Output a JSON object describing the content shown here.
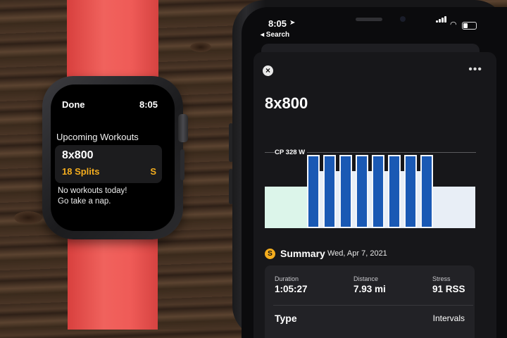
{
  "watch": {
    "done_label": "Done",
    "time": "8:05",
    "section_title": "Upcoming Workouts",
    "workout_name": "8x800",
    "splits": "18 Splits",
    "app_badge": "S",
    "empty_message_line1": "No workouts today!",
    "empty_message_line2": "Go take a nap."
  },
  "phone": {
    "status": {
      "time": "8:05",
      "location_icon": "location-arrow-icon",
      "back_label": "◂ Search"
    },
    "sheet": {
      "close_icon": "close-icon",
      "more_icon": "more-icon",
      "title": "8x800",
      "chart_label": "CP 328 W",
      "summary_badge": "S",
      "summary_label": "Summary",
      "summary_date": "Wed, Apr 7, 2021",
      "stats": [
        {
          "label": "Duration",
          "value": "1:05:27"
        },
        {
          "label": "Distance",
          "value": "7.93 mi"
        },
        {
          "label": "Stress",
          "value": "91 RSS"
        }
      ],
      "type_label": "Type",
      "type_value": "Intervals"
    }
  },
  "chart_data": {
    "type": "bar",
    "title": "",
    "reference_line": {
      "label": "CP 328 W"
    },
    "segments": [
      {
        "kind": "warmup",
        "level": 0.45
      },
      {
        "kind": "work",
        "level": 0.8
      },
      {
        "kind": "recovery",
        "level": 0.62
      },
      {
        "kind": "work",
        "level": 0.8
      },
      {
        "kind": "recovery",
        "level": 0.62
      },
      {
        "kind": "work",
        "level": 0.8
      },
      {
        "kind": "recovery",
        "level": 0.62
      },
      {
        "kind": "work",
        "level": 0.8
      },
      {
        "kind": "recovery",
        "level": 0.62
      },
      {
        "kind": "work",
        "level": 0.8
      },
      {
        "kind": "recovery",
        "level": 0.62
      },
      {
        "kind": "work",
        "level": 0.8
      },
      {
        "kind": "recovery",
        "level": 0.62
      },
      {
        "kind": "work",
        "level": 0.8
      },
      {
        "kind": "recovery",
        "level": 0.62
      },
      {
        "kind": "work",
        "level": 0.8
      },
      {
        "kind": "cooldown",
        "level": 0.45
      }
    ],
    "colors": {
      "warmup": "#dcf5ea",
      "work": "#1a59b4",
      "recovery": "#e8eef6",
      "cooldown": "#e8eef6"
    }
  }
}
